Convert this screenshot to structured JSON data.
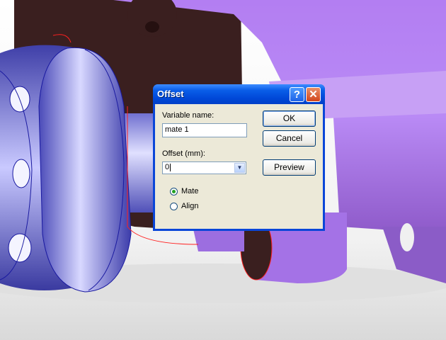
{
  "dialog": {
    "title": "Offset",
    "help_label": "?",
    "close_label": "✕",
    "variable_name_label": "Variable name:",
    "variable_name_value": "mate 1",
    "offset_label": "Offset (mm):",
    "offset_value": "0",
    "ok_label": "OK",
    "cancel_label": "Cancel",
    "preview_label": "Preview",
    "mate_label": "Mate",
    "align_label": "Align",
    "selected_option": "Mate"
  },
  "colors": {
    "model_purple": "#b07cf0",
    "model_dark": "#3a1f1f",
    "wheel_blue": "#8a8ae8",
    "floor": "#e8e8e8"
  }
}
